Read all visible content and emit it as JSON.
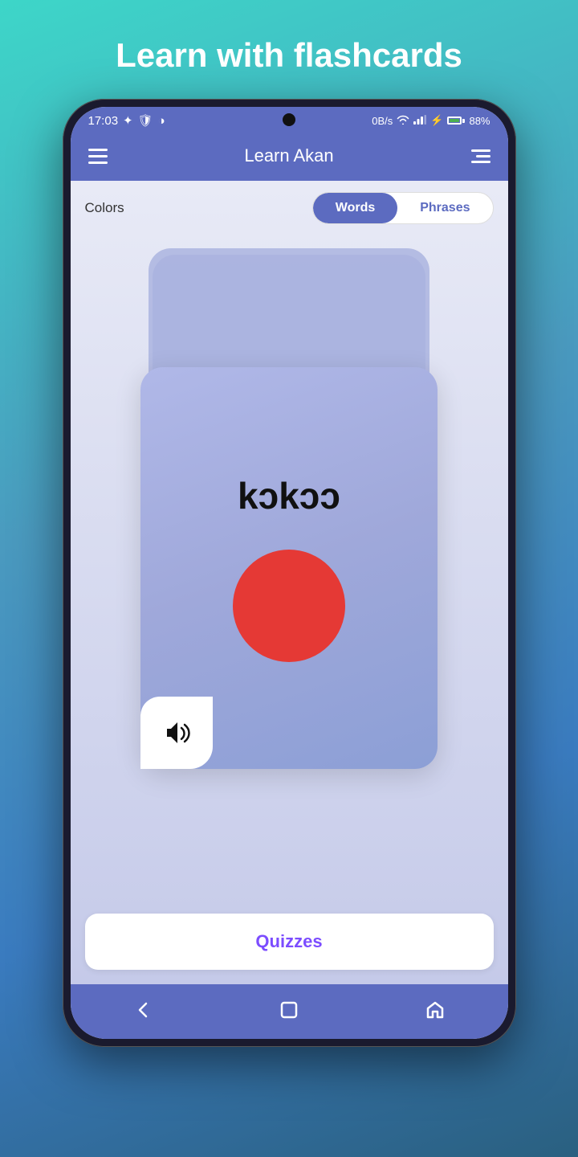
{
  "page": {
    "title": "Learn with flashcards",
    "background_gradient_start": "#3dd6c8",
    "background_gradient_end": "#2a6080"
  },
  "status_bar": {
    "time": "17:03",
    "data_speed": "0B/s",
    "battery_percent": "88%"
  },
  "top_nav": {
    "title": "Learn Akan",
    "menu_icon": "hamburger",
    "filter_icon": "sliders"
  },
  "tabs": {
    "words_label": "Words",
    "phrases_label": "Phrases",
    "active": "words"
  },
  "category": {
    "label": "Colors"
  },
  "flashcard": {
    "word": "kɔkɔɔ",
    "color_display": "#e53935",
    "color_name": "red"
  },
  "sound_button": {
    "label": "play-audio"
  },
  "quiz_button": {
    "label": "Quizzes"
  },
  "bottom_nav": {
    "square_icon": "square",
    "home_icon": "home",
    "back_icon": "back-arrow"
  }
}
